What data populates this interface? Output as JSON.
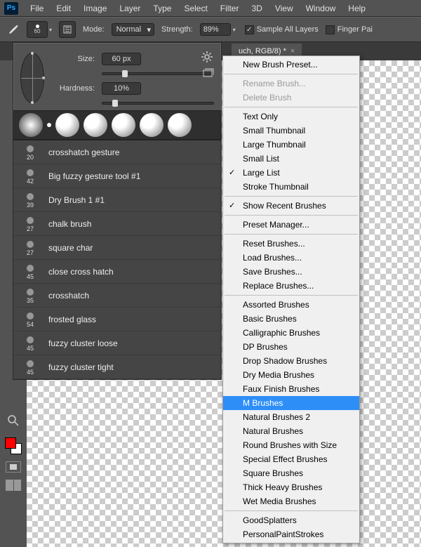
{
  "menubar": {
    "logo": "Ps",
    "items": [
      "File",
      "Edit",
      "Image",
      "Layer",
      "Type",
      "Select",
      "Filter",
      "3D",
      "View",
      "Window",
      "Help"
    ]
  },
  "options": {
    "brush_size_num": "60",
    "mode_label": "Mode:",
    "mode_value": "Normal",
    "strength_label": "Strength:",
    "strength_value": "89%",
    "sample_all_label": "Sample All Layers",
    "sample_all_checked": true,
    "finger_label": "Finger Pai"
  },
  "tab": {
    "title": "uch, RGB/8) *"
  },
  "brush_panel": {
    "size_label": "Size:",
    "size_value": "60 px",
    "hardness_label": "Hardness:",
    "hardness_value": "10%",
    "brushes": [
      {
        "size": "20",
        "name": "crosshatch gesture"
      },
      {
        "size": "42",
        "name": "Big fuzzy gesture tool #1"
      },
      {
        "size": "39",
        "name": "Dry Brush 1 #1"
      },
      {
        "size": "27",
        "name": "chalk brush"
      },
      {
        "size": "27",
        "name": "square char"
      },
      {
        "size": "45",
        "name": "close cross hatch"
      },
      {
        "size": "35",
        "name": "crosshatch"
      },
      {
        "size": "54",
        "name": "frosted glass"
      },
      {
        "size": "45",
        "name": "fuzzy cluster loose"
      },
      {
        "size": "45",
        "name": "fuzzy cluster tight"
      }
    ]
  },
  "context_menu": {
    "items": [
      {
        "label": "New Brush Preset..."
      },
      {
        "sep": true
      },
      {
        "label": "Rename Brush...",
        "disabled": true
      },
      {
        "label": "Delete Brush",
        "disabled": true
      },
      {
        "sep": true
      },
      {
        "label": "Text Only"
      },
      {
        "label": "Small Thumbnail"
      },
      {
        "label": "Large Thumbnail"
      },
      {
        "label": "Small List"
      },
      {
        "label": "Large List",
        "checked": true
      },
      {
        "label": "Stroke Thumbnail"
      },
      {
        "sep": true
      },
      {
        "label": "Show Recent Brushes",
        "checked": true
      },
      {
        "sep": true
      },
      {
        "label": "Preset Manager..."
      },
      {
        "sep": true
      },
      {
        "label": "Reset Brushes..."
      },
      {
        "label": "Load Brushes..."
      },
      {
        "label": "Save Brushes..."
      },
      {
        "label": "Replace Brushes..."
      },
      {
        "sep": true
      },
      {
        "label": "Assorted Brushes"
      },
      {
        "label": "Basic Brushes"
      },
      {
        "label": "Calligraphic Brushes"
      },
      {
        "label": "DP Brushes"
      },
      {
        "label": "Drop Shadow Brushes"
      },
      {
        "label": "Dry Media Brushes"
      },
      {
        "label": "Faux Finish Brushes"
      },
      {
        "label": "M Brushes",
        "highlight": true
      },
      {
        "label": "Natural Brushes 2"
      },
      {
        "label": "Natural Brushes"
      },
      {
        "label": "Round Brushes with Size"
      },
      {
        "label": "Special Effect Brushes"
      },
      {
        "label": "Square Brushes"
      },
      {
        "label": "Thick Heavy Brushes"
      },
      {
        "label": "Wet Media Brushes"
      },
      {
        "sep": true
      },
      {
        "label": "GoodSplatters"
      },
      {
        "label": "PersonalPaintStrokes"
      }
    ]
  }
}
